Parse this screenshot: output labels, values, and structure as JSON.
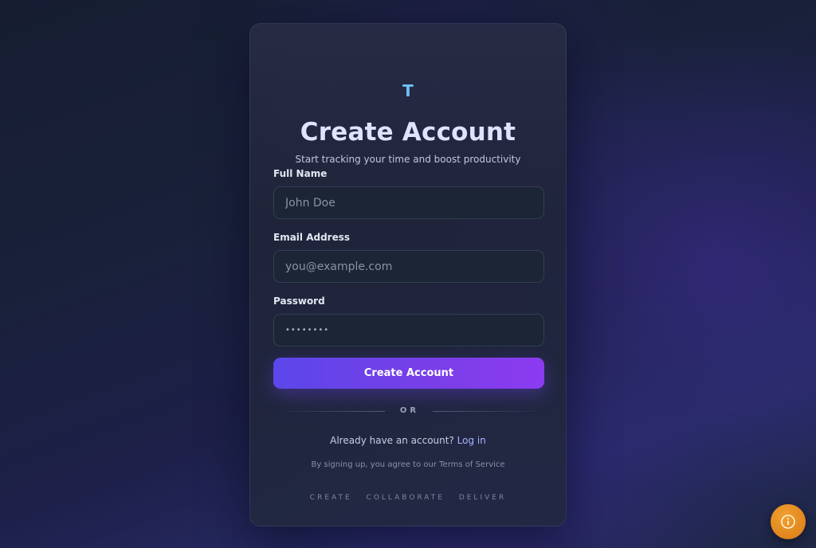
{
  "brand": {
    "logo_text": "T"
  },
  "header": {
    "title": "Create Account",
    "subtitle": "Start tracking your time and boost productivity"
  },
  "form": {
    "full_name": {
      "label": "Full Name",
      "placeholder": "John Doe",
      "value": ""
    },
    "email": {
      "label": "Email Address",
      "placeholder": "you@example.com",
      "value": ""
    },
    "password": {
      "label": "Password",
      "placeholder": "••••••••",
      "value": ""
    },
    "submit_label": "Create Account"
  },
  "divider": {
    "text": "OR"
  },
  "login_prompt": {
    "text": "Already have an account?",
    "link_label": "Log in"
  },
  "terms_text": "By signing up, you agree to our Terms of Service",
  "tagline": [
    "CREATE",
    "COLLABORATE",
    "DELIVER"
  ],
  "info_button": {
    "icon": "info-circle-icon"
  },
  "colors": {
    "accent_start": "#5b47ea",
    "accent_end": "#8c3bf0",
    "logo": "#6fc0f5",
    "link": "#a8b4ff",
    "info_button": "#e58a1f"
  }
}
